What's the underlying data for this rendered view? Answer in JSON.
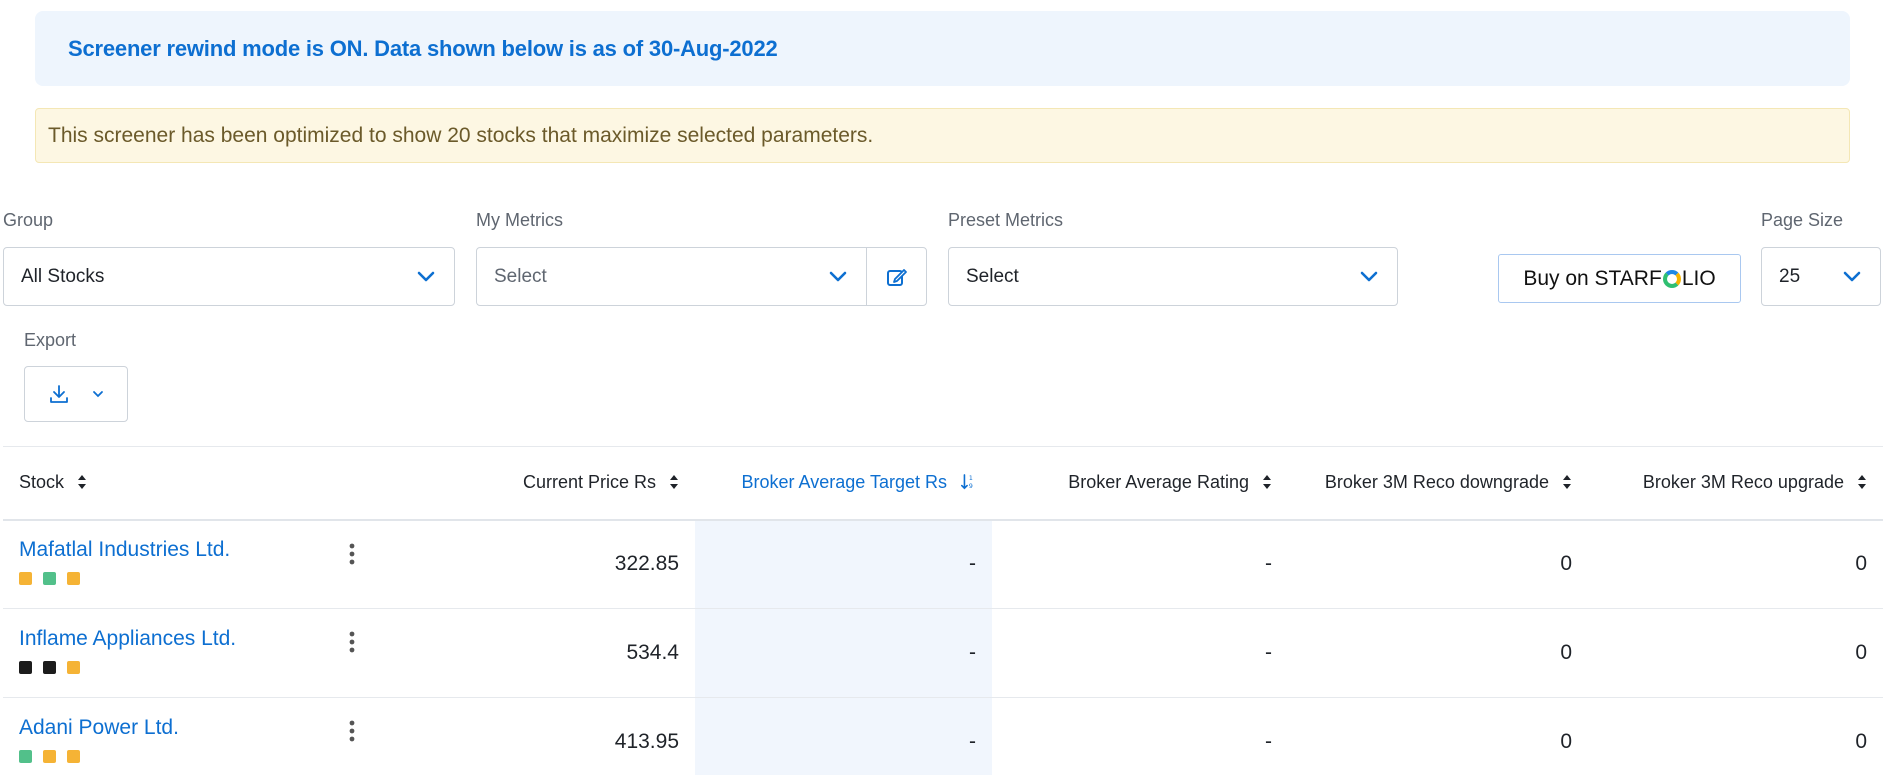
{
  "banner": {
    "rewind_text": "Screener rewind mode is ON. Data shown below is as of 30-Aug-2022",
    "optimized_text": "This screener has been optimized to show 20 stocks that maximize selected parameters."
  },
  "filters": {
    "group_label": "Group",
    "group_value": "All Stocks",
    "my_metrics_label": "My Metrics",
    "my_metrics_value": "Select",
    "preset_metrics_label": "Preset Metrics",
    "preset_metrics_value": "Select",
    "starfolio_prefix": "Buy on STARF",
    "starfolio_suffix": "LIO",
    "page_size_label": "Page Size",
    "page_size_value": "25",
    "export_label": "Export"
  },
  "table": {
    "columns": [
      "Stock",
      "Current Price Rs",
      "Broker Average Target Rs",
      "Broker Average Rating",
      "Broker 3M Reco downgrade",
      "Broker 3M Reco upgrade"
    ],
    "rows": [
      {
        "name": "Mafatlal Industries Ltd.",
        "price": "322.85",
        "target": "-",
        "rating": "-",
        "downgrade": "0",
        "upgrade": "0",
        "dots": [
          "#f5b335",
          "#52c08a",
          "#f5b335"
        ]
      },
      {
        "name": "Inflame Appliances Ltd.",
        "price": "534.4",
        "target": "-",
        "rating": "-",
        "downgrade": "0",
        "upgrade": "0",
        "dots": [
          "#1c1c1c",
          "#1c1c1c",
          "#f5b335"
        ]
      },
      {
        "name": "Adani Power Ltd.",
        "price": "413.95",
        "target": "-",
        "rating": "-",
        "downgrade": "0",
        "upgrade": "0",
        "dots": [
          "#52c08a",
          "#f5b335",
          "#f5b335"
        ]
      }
    ]
  },
  "colors": {
    "accent": "#0d6fd1",
    "highlight_column": "#f1f6fd"
  },
  "icons": [
    "chevron-down-icon",
    "edit-icon",
    "download-icon",
    "sort-icon",
    "sort-ascending-icon",
    "kebab-menu-icon"
  ]
}
